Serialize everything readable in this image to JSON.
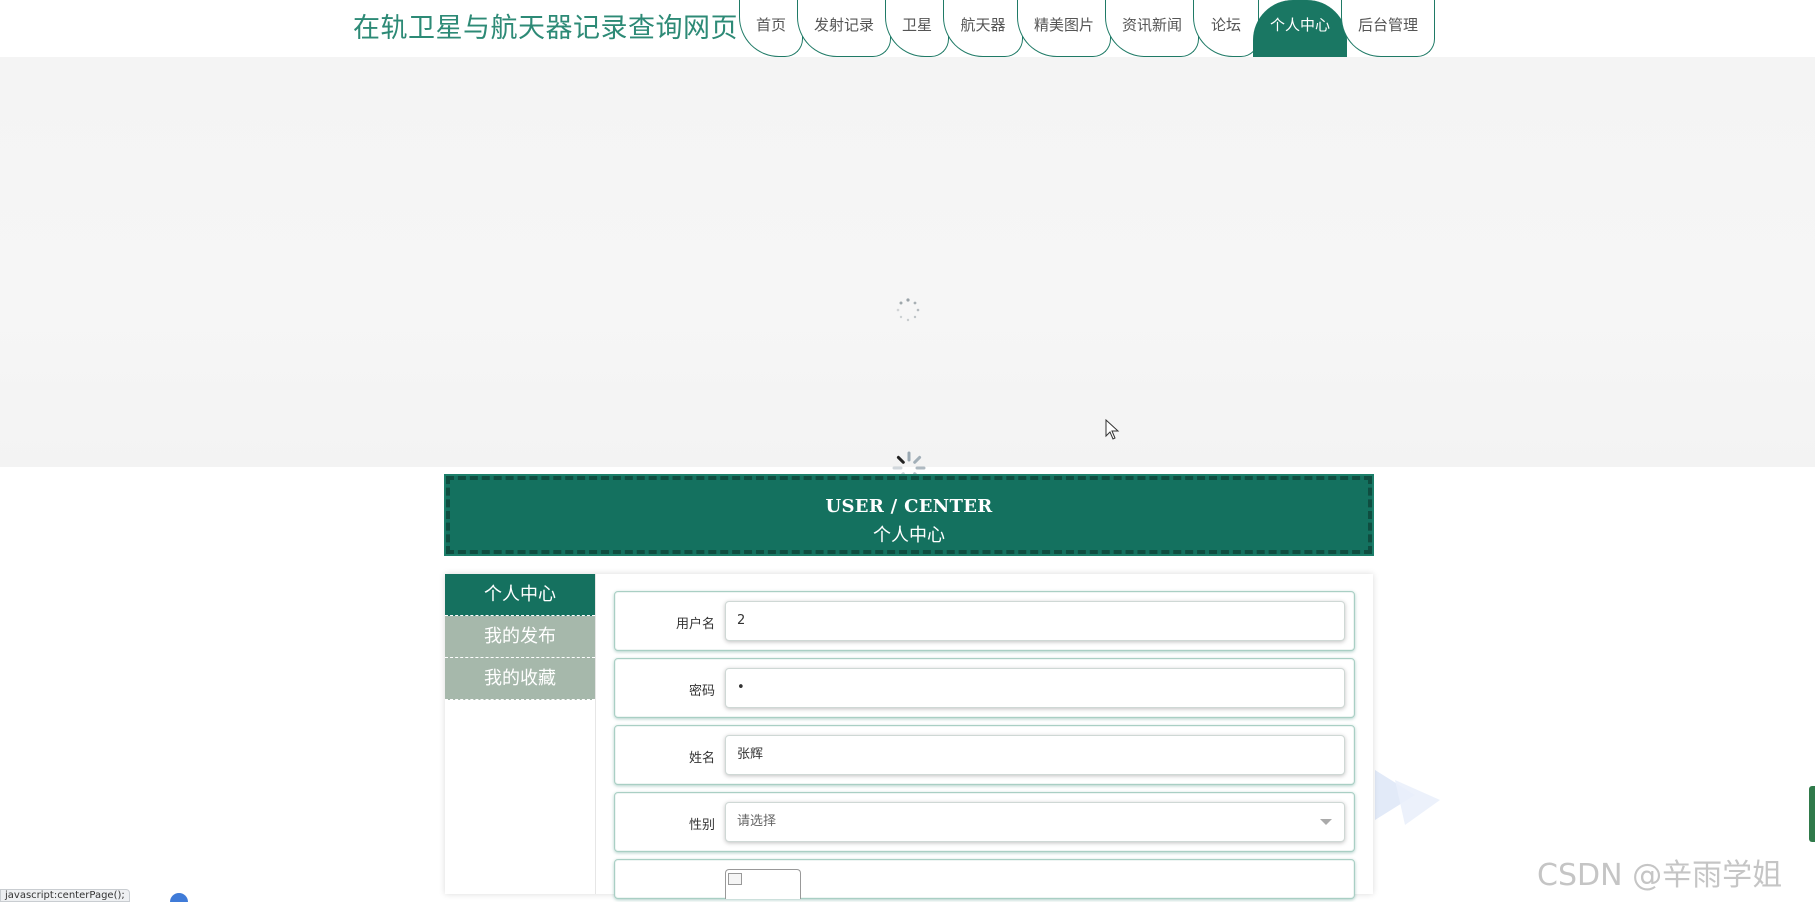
{
  "site": {
    "title": "在轨卫星与航天器记录查询网页"
  },
  "nav": {
    "items": [
      {
        "label": "首页",
        "active": false
      },
      {
        "label": "发射记录",
        "active": false
      },
      {
        "label": "卫星",
        "active": false
      },
      {
        "label": "航天器",
        "active": false
      },
      {
        "label": "精美图片",
        "active": false
      },
      {
        "label": "资讯新闻",
        "active": false
      },
      {
        "label": "论坛",
        "active": false
      },
      {
        "label": "个人中心",
        "active": true
      },
      {
        "label": "后台管理",
        "active": false
      }
    ]
  },
  "section": {
    "title_en": "USER / CENTER",
    "title_cn": "个人中心"
  },
  "sidebar": {
    "items": [
      {
        "label": "个人中心",
        "active": true
      },
      {
        "label": "我的发布",
        "active": false
      },
      {
        "label": "我的收藏",
        "active": false
      }
    ]
  },
  "form": {
    "username": {
      "label": "用户名",
      "value": "2"
    },
    "password": {
      "label": "密码",
      "value": "•"
    },
    "name": {
      "label": "姓名",
      "value": "张辉"
    },
    "gender": {
      "label": "性别",
      "value": "请选择"
    }
  },
  "watermark": "CSDN @辛雨学姐",
  "statusbar": {
    "text": "javascript:centerPage();"
  },
  "colors": {
    "primary": "#1a7763",
    "sidebar_inactive": "#a6b8ab",
    "title_text": "#2d8a76"
  }
}
